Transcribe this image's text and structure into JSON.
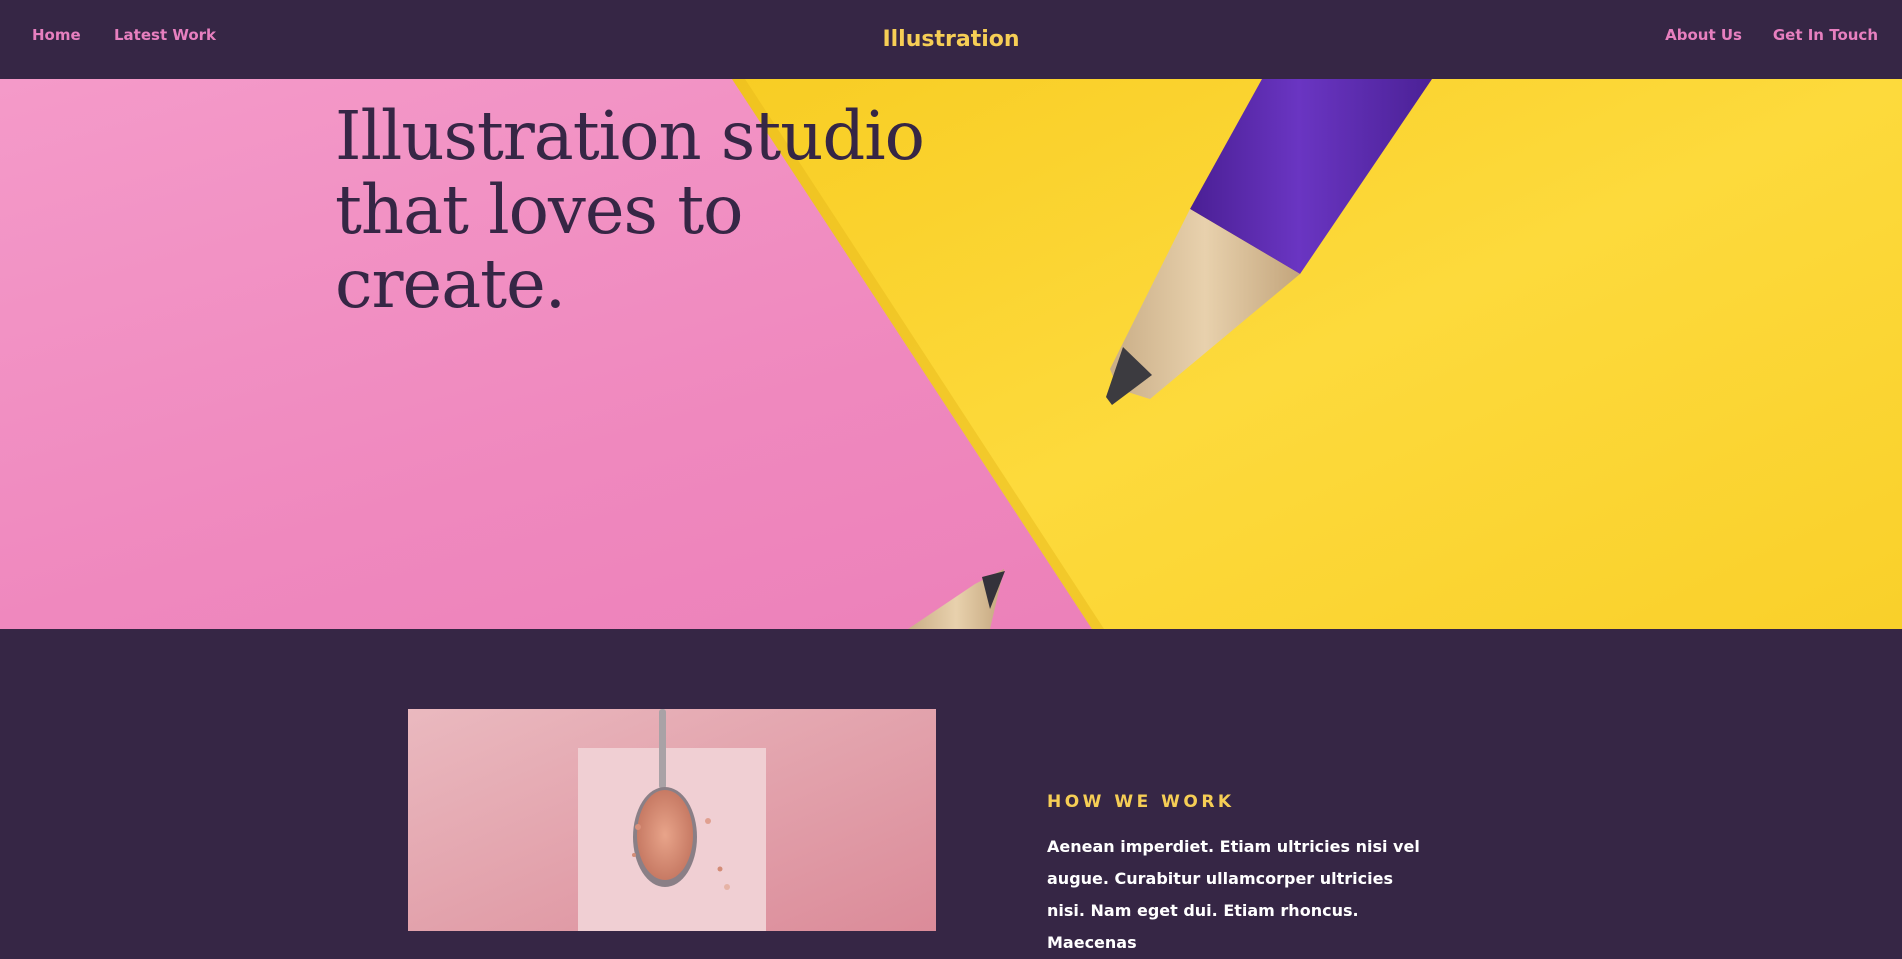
{
  "header": {
    "nav_left": [
      "Home",
      "Latest Work"
    ],
    "site_title": "Illustration",
    "nav_right": [
      "About Us",
      "Get In Touch"
    ]
  },
  "hero": {
    "heading": "Illustration studio that loves to create."
  },
  "how_we_work": {
    "heading": "HOW WE WORK",
    "body": "Aenean imperdiet. Etiam ultricies nisi vel augue. Curabitur ullamcorper ultricies nisi. Nam eget dui. Etiam rhoncus. Maecenas"
  },
  "colors": {
    "background": "#362645",
    "nav_link": "#e77fbf",
    "accent": "#f6ce55",
    "hero_pink": "#f08cc0",
    "hero_yellow": "#fbd22e",
    "pencil_purple": "#5a2aa8"
  },
  "icons": {
    "hero_image": "pencils-on-pink-and-yellow-paper",
    "content_image": "spoon-with-pink-salt"
  }
}
